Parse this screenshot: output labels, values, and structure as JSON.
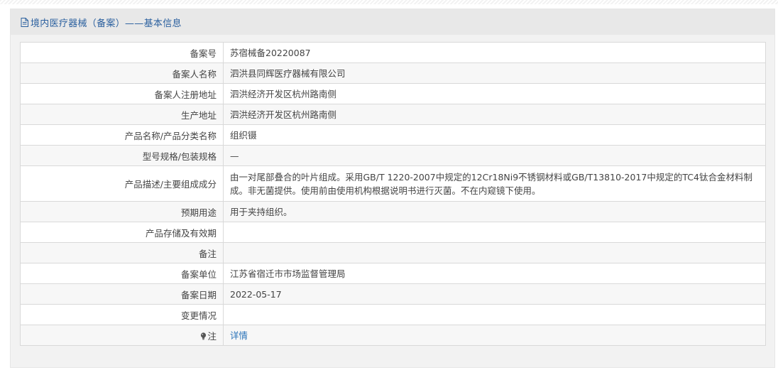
{
  "panel": {
    "title": "境内医疗器械（备案）——基本信息",
    "title_icon": "document-icon"
  },
  "rows": [
    {
      "label": "备案号",
      "value": "苏宿械备20220087"
    },
    {
      "label": "备案人名称",
      "value": "泗洪县同辉医疗器械有限公司"
    },
    {
      "label": "备案人注册地址",
      "value": "泗洪经济开发区杭州路南侧"
    },
    {
      "label": "生产地址",
      "value": "泗洪经济开发区杭州路南侧"
    },
    {
      "label": "产品名称/产品分类名称",
      "value": "组织镊"
    },
    {
      "label": "型号规格/包装规格",
      "value": "—"
    },
    {
      "label": "产品描述/主要组成成分",
      "value": "由一对尾部叠合的叶片组成。采用GB/T 1220-2007中规定的12Cr18Ni9不锈钢材料或GB/T13810-2017中规定的TC4钛合金材料制成。非无菌提供。使用前由使用机构根据说明书进行灭菌。不在内窥镜下使用。"
    },
    {
      "label": "预期用途",
      "value": "用于夹持组织。"
    },
    {
      "label": "产品存储及有效期",
      "value": ""
    },
    {
      "label": "备注",
      "value": ""
    },
    {
      "label": "备案单位",
      "value": "江苏省宿迁市市场监督管理局"
    },
    {
      "label": "备案日期",
      "value": "2022-05-17"
    },
    {
      "label": "变更情况",
      "value": ""
    }
  ],
  "note_row": {
    "label": "注",
    "label_icon": "lightbulb-icon",
    "link_text": "详情"
  },
  "colors": {
    "title_text": "#2a5f9e",
    "link": "#2a73b9",
    "panel_bg": "#f2f2f2",
    "title_bar_bg": "#e8e8e8",
    "border": "#d9d9d9"
  }
}
